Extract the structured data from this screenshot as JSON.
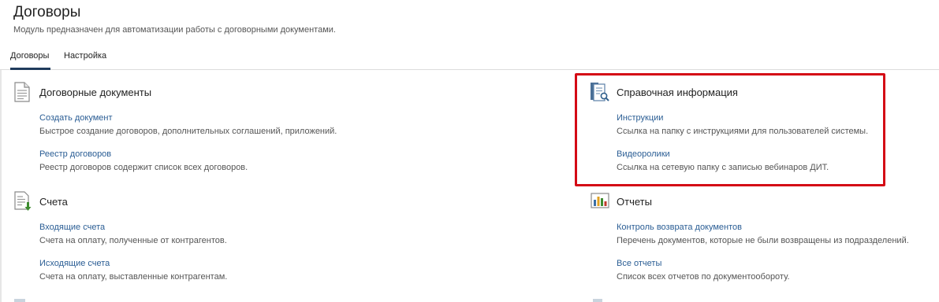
{
  "header": {
    "title": "Договоры",
    "subtitle": "Модуль предназначен для автоматизации работы с договорными документами."
  },
  "tabs": [
    {
      "label": "Договоры",
      "active": true
    },
    {
      "label": "Настройка",
      "active": false
    }
  ],
  "sections": {
    "contract_docs": {
      "title": "Договорные документы",
      "icon": "document-icon",
      "items": [
        {
          "link": "Создать документ",
          "desc": "Быстрое создание договоров, дополнительных соглашений, приложений."
        },
        {
          "link": "Реестр договоров",
          "desc": "Реестр договоров содержит список всех договоров."
        }
      ]
    },
    "reference": {
      "title": "Справочная информация",
      "icon": "reference-search-icon",
      "items": [
        {
          "link": "Инструкции",
          "desc": "Ссылка на папку с инструкциями для пользователей системы."
        },
        {
          "link": "Видеоролики",
          "desc": "Ссылка на сетевую папку с записью вебинаров ДИТ."
        }
      ]
    },
    "invoices": {
      "title": "Счета",
      "icon": "invoice-icon",
      "items": [
        {
          "link": "Входящие счета",
          "desc": "Счета на оплату, полученные от контрагентов."
        },
        {
          "link": "Исходящие счета",
          "desc": "Счета на оплату, выставленные контрагентам."
        }
      ]
    },
    "reports": {
      "title": "Отчеты",
      "icon": "chart-icon",
      "items": [
        {
          "link": "Контроль возврата документов",
          "desc": "Перечень документов, которые не были возвращены из подразделений."
        },
        {
          "link": "Все отчеты",
          "desc": "Список всех отчетов по документообороту."
        }
      ]
    }
  },
  "colors": {
    "link": "#2a5d94",
    "highlight": "#d40a15",
    "active_tab": "#1f3b5c"
  }
}
